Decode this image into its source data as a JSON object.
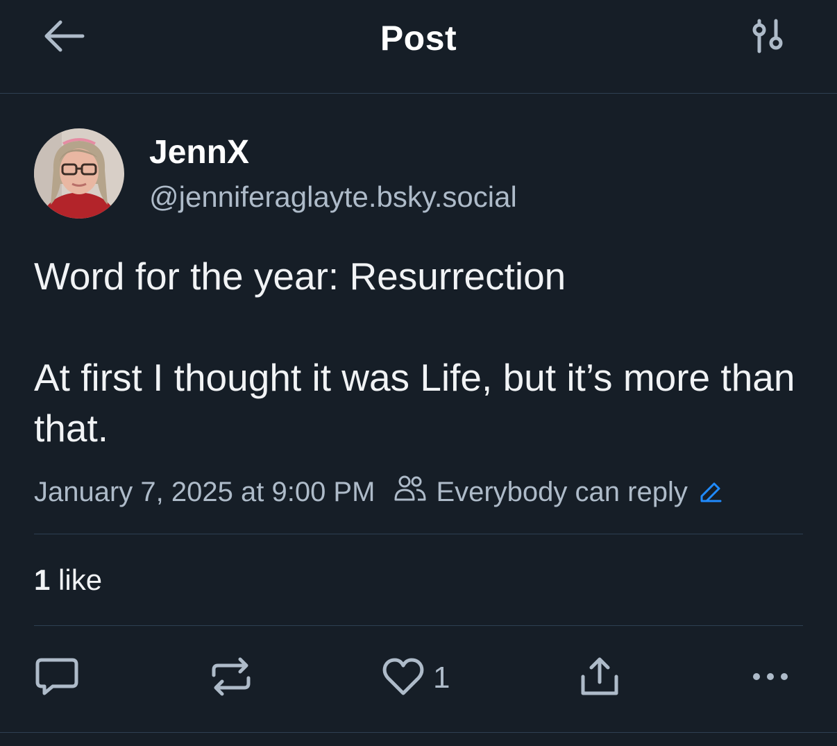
{
  "header": {
    "title": "Post",
    "back_icon": "arrow-left-icon",
    "settings_icon": "sliders-icon"
  },
  "post": {
    "author_name": "JennX",
    "author_handle": "@jenniferaglayte.bsky.social",
    "text_line1": "Word for the year: Resurrection",
    "text_line2": "At first I thought it was Life, but it’s more than that.",
    "timestamp": "January 7, 2025 at 9:00 PM",
    "reply_setting": "Everybody can reply",
    "like_count_number": "1",
    "like_count_label": "like",
    "actions": {
      "reply_icon": "comment-icon",
      "repost_icon": "repost-icon",
      "like_icon": "heart-icon",
      "like_count": "1",
      "share_icon": "share-icon",
      "more_icon": "more-dots-icon"
    }
  },
  "colors": {
    "background": "#161e27",
    "divider": "#2e4052",
    "secondary_text": "#aebbc9",
    "accent": "#208bfe"
  }
}
